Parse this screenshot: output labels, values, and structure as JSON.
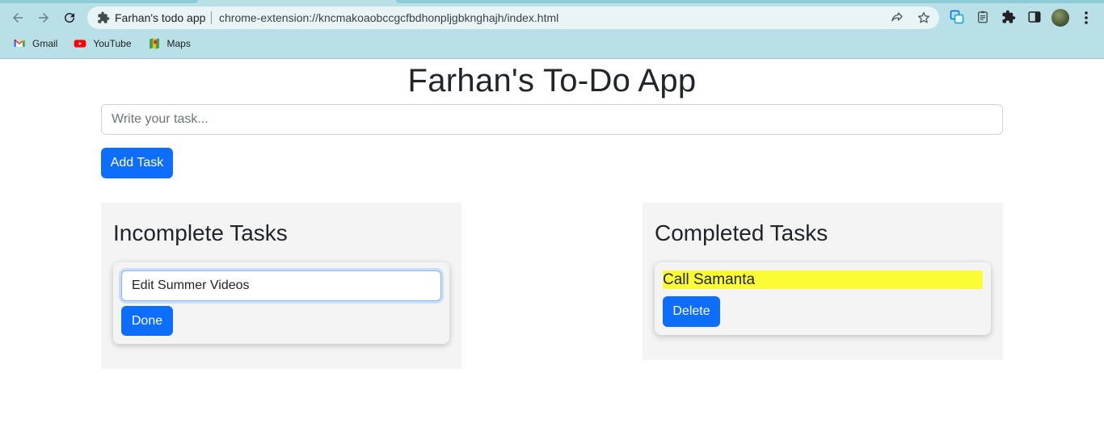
{
  "browser": {
    "tab_title": "Farhan's todo app",
    "url": "chrome-extension://kncmakoaobccgcfbdhonpljgbknghajh/index.html",
    "bookmarks": [
      {
        "label": "Gmail",
        "icon": "gmail-icon"
      },
      {
        "label": "YouTube",
        "icon": "youtube-icon"
      },
      {
        "label": "Maps",
        "icon": "maps-icon"
      }
    ]
  },
  "app": {
    "title": "Farhan's To-Do App",
    "task_input": {
      "placeholder": "Write your task...",
      "value": ""
    },
    "add_button_label": "Add Task",
    "incomplete": {
      "heading": "Incomplete Tasks",
      "tasks": [
        {
          "text": "Edit Summer Videos",
          "action_label": "Done"
        }
      ]
    },
    "completed": {
      "heading": "Completed Tasks",
      "tasks": [
        {
          "text": "Call Samanta",
          "action_label": "Delete"
        }
      ]
    }
  },
  "colors": {
    "primary": "#0d6efd",
    "panel_bg": "#f4f4f4",
    "highlight": "#fbfb36",
    "chrome_bg": "#b9e0e6"
  }
}
